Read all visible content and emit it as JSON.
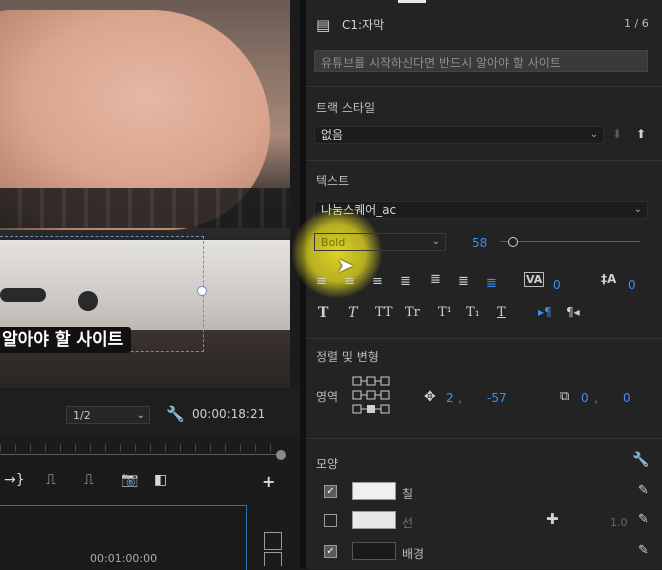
{
  "monitor": {
    "subtitle_text": "알아야 할 사이트",
    "zoom": "1/2",
    "timecode": "00:00:18:21"
  },
  "timeline": {
    "timecode": "00:01:00:00"
  },
  "graphics_panel": {
    "clip_name": "C1:자막",
    "page_counter": "1 / 6",
    "text_input_value": "유튜브를 시작하신다면 반드시 알아야 할 사이트",
    "track_style": {
      "heading": "트랙 스타일",
      "value": "없음"
    },
    "text": {
      "heading": "텍스트",
      "font": "나눔스퀘어_ac",
      "weight": "Bold",
      "size": "58",
      "size_slider_fraction": 0.06,
      "tracking": "0",
      "leading": "0"
    },
    "align_transform": {
      "heading": "정렬 및 변형",
      "region_label": "영역",
      "pos_x": "2",
      "pos_y": "-57",
      "anchor_x": "0",
      "anchor_y": "0"
    },
    "appearance": {
      "heading": "모양",
      "fill_label": "칠",
      "stroke_label": "선",
      "stroke_width": "1.0",
      "background_label": "배경"
    }
  },
  "colors": {
    "accent": "#3d8ff0",
    "panel_bg": "#232323"
  }
}
